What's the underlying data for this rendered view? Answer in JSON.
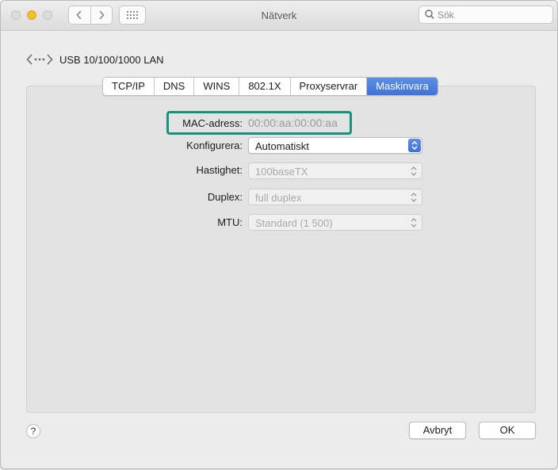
{
  "window": {
    "title": "Nätverk"
  },
  "toolbar": {
    "search_placeholder": "Sök"
  },
  "device": {
    "name": "USB 10/100/1000 LAN"
  },
  "tabs": [
    {
      "label": "TCP/IP",
      "active": false
    },
    {
      "label": "DNS",
      "active": false
    },
    {
      "label": "WINS",
      "active": false
    },
    {
      "label": "802.1X",
      "active": false
    },
    {
      "label": "Proxyservrar",
      "active": false
    },
    {
      "label": "Maskinvara",
      "active": true
    }
  ],
  "hardware": {
    "mac_label": "MAC-adress:",
    "mac_value": "00:00:aa:00:00:aa",
    "configure_label": "Konfigurera:",
    "configure_value": "Automatiskt",
    "speed_label": "Hastighet:",
    "speed_value": "100baseTX",
    "duplex_label": "Duplex:",
    "duplex_value": "full duplex",
    "mtu_label": "MTU:",
    "mtu_value": "Standard (1 500)"
  },
  "buttons": {
    "help": "?",
    "cancel": "Avbryt",
    "ok": "OK"
  },
  "colors": {
    "accent": "#3f72d6",
    "highlight_box": "#17927e"
  }
}
